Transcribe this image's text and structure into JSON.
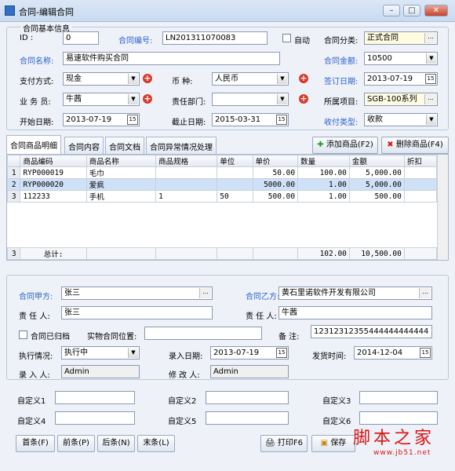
{
  "window": {
    "title": "合同-编辑合同",
    "min": "–",
    "max": "□",
    "close": "✕"
  },
  "basic": {
    "group_title": "合同基本信息",
    "id_label": "ID :",
    "id_value": "0",
    "code_label": "合同编号:",
    "code_value": "LN201311070083",
    "auto_label": "自动",
    "category_label": "合同分类:",
    "category_value": "正式合同",
    "name_label": "合同名称:",
    "name_value": "易速软件购买合同",
    "amount_label": "合同金额:",
    "amount_value": "10500",
    "pay_label": "支付方式:",
    "pay_value": "现金",
    "currency_label": "币    种:",
    "currency_value": "人民币",
    "sign_label": "签订日期:",
    "sign_value": "2013-07-19",
    "staff_label": "业 务 员:",
    "staff_value": "牛茜",
    "dept_label": "责任部门:",
    "dept_value": "",
    "project_label": "所属项目:",
    "project_value": "SGB-100系列",
    "start_label": "开始日期:",
    "start_value": "2013-07-19",
    "end_label": "截止日期:",
    "end_value": "2015-03-31",
    "receipt_label": "收付类型:",
    "receipt_value": "收款"
  },
  "tabs": [
    "合同商品明细",
    "合同内容",
    "合同文档",
    "合同异常情况处理"
  ],
  "grid_actions": {
    "add": "添加商品(F2)",
    "delete": "删除商品(F4)"
  },
  "grid": {
    "columns": [
      "商品编码",
      "商品名称",
      "商品规格",
      "单位",
      "单价",
      "数量",
      "金额",
      "折扣"
    ],
    "rows": [
      {
        "n": "1",
        "code": "RYP000019",
        "name": "毛巾",
        "spec": "",
        "unit": "",
        "price": "50.00",
        "qty": "100.00",
        "amount": "5,000.00"
      },
      {
        "n": "2",
        "code": "RYP000020",
        "name": "爱疯",
        "spec": "",
        "unit": "",
        "price": "5000.00",
        "qty": "1.00",
        "amount": "5,000.00"
      },
      {
        "n": "3",
        "code": "112233",
        "name": "手机",
        "spec": "1",
        "unit": "50",
        "price": "500.00",
        "qty": "1.00",
        "amount": "500.00"
      }
    ],
    "total_row": {
      "n": "3",
      "label": "总计:",
      "qty": "102.00",
      "amount": "10,500.00"
    }
  },
  "party": {
    "a_label": "合同甲方:",
    "a_value": "张三",
    "b_label": "合同乙方:",
    "b_value": "黄石里诺软件开发有限公司",
    "a_rep_label": "责 任 人:",
    "a_rep_value": "张三",
    "b_rep_label": "责 任 人:",
    "b_rep_value": "牛茜",
    "archived_label": "合同已归档",
    "physical_label": "实物合同位置:",
    "physical_value": "",
    "note_label": "备    注:",
    "note_value": "12312312355444444444444",
    "exec_label": "执行情况:",
    "exec_value": "执行中",
    "entry_date_label": "录入日期:",
    "entry_date_value": "2013-07-19",
    "invoice_label": "发货时间:",
    "invoice_value": "2014-12-04",
    "entered_by_label": "录 入 人:",
    "entered_by_value": "Admin",
    "modified_by_label": "修 改 人:",
    "modified_by_value": "Admin"
  },
  "custom": {
    "c1": "自定义1",
    "c2": "自定义2",
    "c3": "自定义3",
    "c4": "自定义4",
    "c5": "自定义5",
    "c6": "自定义6"
  },
  "footer": {
    "first": "首条(F)",
    "prev": "前条(P)",
    "next": "后条(N)",
    "last": "末条(L)",
    "print": "打印F6",
    "save": "保存",
    "watermark": "脚本之家",
    "watermark_url": "www.jb51.net"
  },
  "colors": {
    "accent": "#2b5fc9",
    "plus": "#d83a2a",
    "selected_row": "#cfe1f7"
  }
}
